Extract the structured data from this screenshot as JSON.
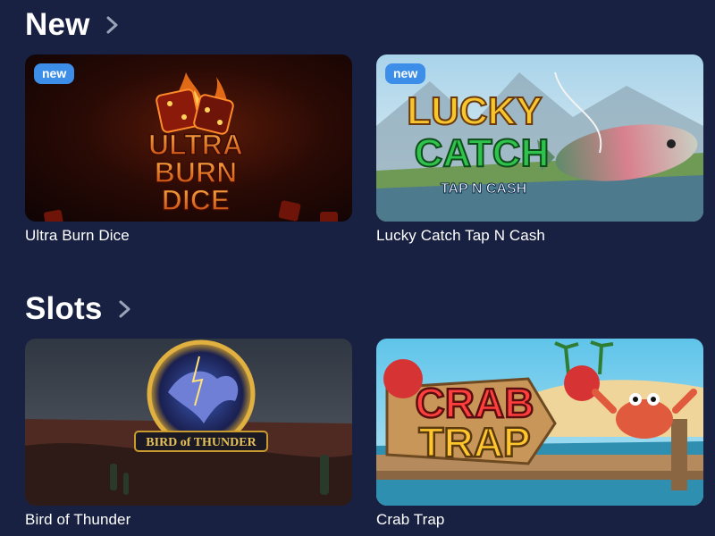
{
  "sections": [
    {
      "title": "New",
      "games": [
        {
          "name": "Ultra Burn Dice",
          "badge": "new",
          "art_lines": [
            "ULTRA",
            "BURN",
            "DICE"
          ]
        },
        {
          "name": "Lucky Catch Tap N Cash",
          "badge": "new",
          "art_lines": [
            "LUCKY",
            "CATCH",
            "TAP N CASH"
          ]
        }
      ]
    },
    {
      "title": "Slots",
      "games": [
        {
          "name": "Bird of Thunder",
          "art_lines": [
            "BIRD of THUNDER"
          ]
        },
        {
          "name": "Crab Trap",
          "art_lines": [
            "CRAB",
            "TRAP"
          ]
        }
      ]
    }
  ],
  "colors": {
    "background": "#182142",
    "badge": "#3d8ee8",
    "text": "#ffffff"
  },
  "icons": {
    "section_more": "chevron-right-icon"
  }
}
